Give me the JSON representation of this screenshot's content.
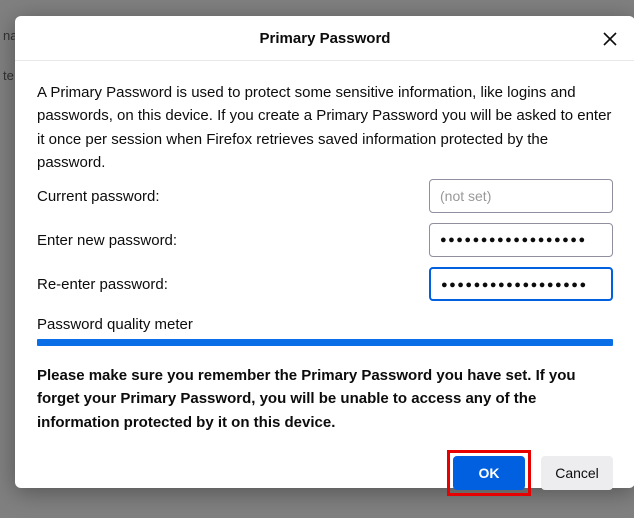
{
  "bg": {
    "line1": "na",
    "line2": "te"
  },
  "dialog": {
    "title": "Primary Password",
    "description": "A Primary Password is used to protect some sensitive information, like logins and passwords, on this device. If you create a Primary Password you will be asked to enter it once per session when Firefox retrieves saved information protected by the password.",
    "current_label": "Current password:",
    "current_placeholder": "(not set)",
    "current_value": "",
    "new_label": "Enter new password:",
    "new_value": "●●●●●●●●●●●●●●●●●●",
    "reenter_label": "Re-enter password:",
    "reenter_value": "●●●●●●●●●●●●●●●●●●",
    "meter_label": "Password quality meter",
    "warning": "Please make sure you remember the Primary Password you have set. If you forget your Primary Password, you will be unable to access any of the information protected by it on this device.",
    "ok_label": "OK",
    "cancel_label": "Cancel"
  }
}
